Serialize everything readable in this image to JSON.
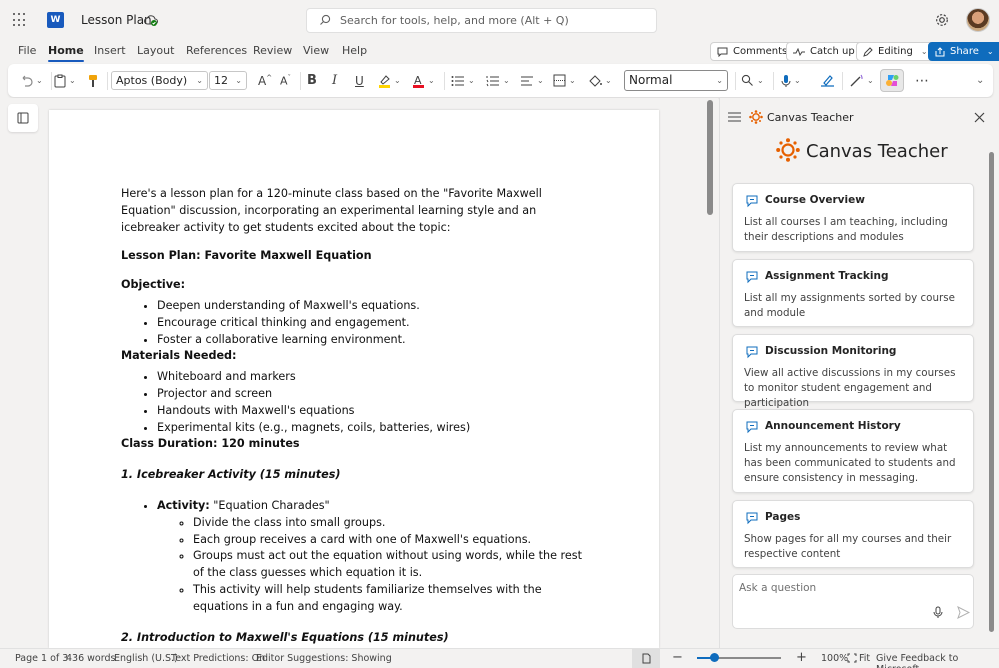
{
  "app": {
    "doc_title": "Lesson Plan",
    "search_placeholder": "Search for tools, help, and more (Alt + Q)"
  },
  "ribbon": {
    "tabs": [
      "File",
      "Home",
      "Insert",
      "Layout",
      "References",
      "Review",
      "View",
      "Help"
    ],
    "active_tab": "Home",
    "comments": "Comments",
    "catchup": "Catch up",
    "editing": "Editing",
    "share": "Share"
  },
  "toolbar": {
    "font": "Aptos (Body)",
    "size": "12",
    "style": "Normal",
    "bold": "B",
    "italic": "I",
    "underline": "U",
    "font_color": "#e81123",
    "highlight_color": "#ffd400"
  },
  "document": {
    "intro": "Here's a lesson plan for a 120-minute class based on the \"Favorite Maxwell Equation\" discussion, incorporating an experimental learning style and an icebreaker activity to get students excited about the topic:",
    "title": "Lesson Plan: Favorite Maxwell Equation",
    "objective_heading": "Objective:",
    "objectives": [
      "Deepen understanding of Maxwell's equations.",
      "Encourage critical thinking and engagement.",
      "Foster a collaborative learning environment."
    ],
    "materials_heading": "Materials Needed:",
    "materials": [
      "Whiteboard and markers",
      "Projector and screen",
      "Handouts with Maxwell's equations",
      "Experimental kits (e.g., magnets, coils, batteries, wires)"
    ],
    "duration": "Class Duration: 120 minutes",
    "section1": "1. Icebreaker Activity (15 minutes)",
    "activity_label": "Activity:",
    "activity_value": " \"Equation Charades\"",
    "activity_steps": [
      "Divide the class into small groups.",
      "Each group receives a card with one of Maxwell's equations.",
      "Groups must act out the equation without using words, while the rest of the class guesses which equation it is.",
      "This activity will help students familiarize themselves with the equations in a fun and engaging way."
    ],
    "section2": "2. Introduction to Maxwell's Equations (15 minutes)"
  },
  "pane": {
    "header": "Canvas Teacher",
    "logo_title": "Canvas Teacher",
    "cards": [
      {
        "title": "Course Overview",
        "desc": "List all courses I am teaching, including their descriptions and modules"
      },
      {
        "title": "Assignment Tracking",
        "desc": "List all my assignments sorted by course and module"
      },
      {
        "title": "Discussion Monitoring",
        "desc": "View all active discussions in my courses to monitor student engagement and participation"
      },
      {
        "title": "Announcement History",
        "desc": "List my announcements to review what has been communicated to students and ensure consistency in messaging."
      },
      {
        "title": "Pages",
        "desc": "Show pages for all my courses and their respective content"
      }
    ],
    "ask_placeholder": "Ask a question"
  },
  "status": {
    "page": "Page 1 of 3",
    "words": "436 words",
    "language": "English (U.S.)",
    "predictions": "Text Predictions: On",
    "suggestions": "Editor Suggestions: Showing",
    "zoom": "100%",
    "fit": "Fit",
    "feedback": "Give Feedback to Microsoft",
    "zoom_level": 0.2
  },
  "colors": {
    "accent": "#0f6cbd",
    "word_blue": "#185abd",
    "canvas_orange": "#e66000"
  }
}
